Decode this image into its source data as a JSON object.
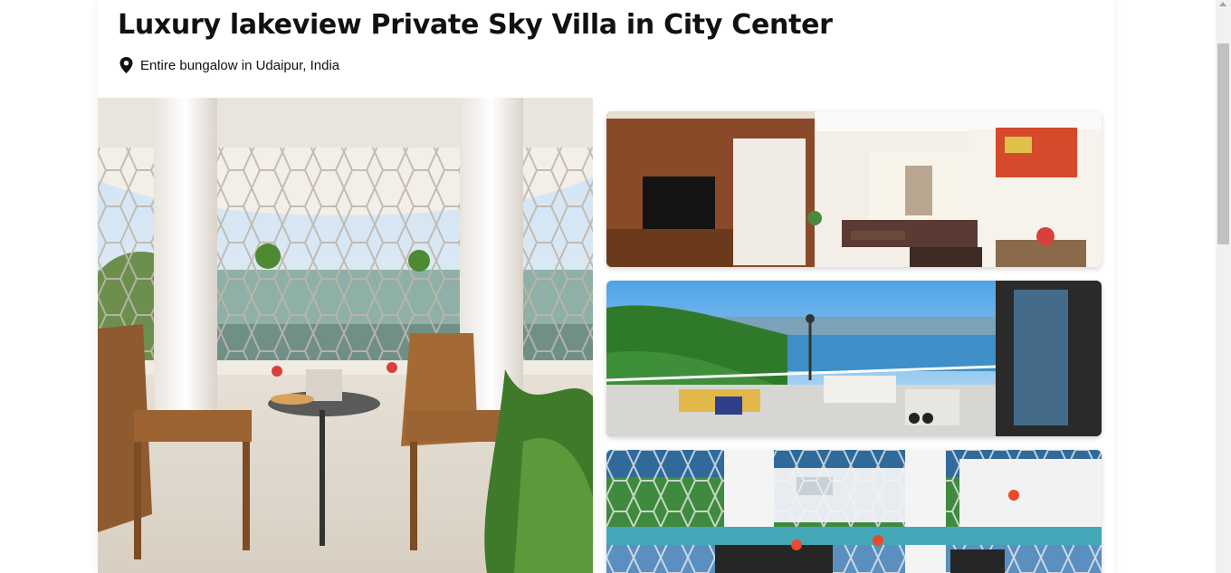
{
  "listing": {
    "title": "Luxury lakeview Private Sky Villa in City Center",
    "location": "Entire bungalow in Udaipur, India"
  },
  "gallery": {
    "photos": [
      {
        "name": "balcony-lounge",
        "subject": "balcony with wooden chairs and lattice windows"
      },
      {
        "name": "living-room",
        "subject": "living room with TV and sofas"
      },
      {
        "name": "terrace-lake-view",
        "subject": "terrace overlooking the lake"
      },
      {
        "name": "balcony-city-view",
        "subject": "lattice balcony overlooking the city"
      }
    ]
  },
  "colors": {
    "accent": "#111111",
    "scrollbar_track": "#f1f1f1",
    "scrollbar_thumb": "#c1c1c1"
  }
}
